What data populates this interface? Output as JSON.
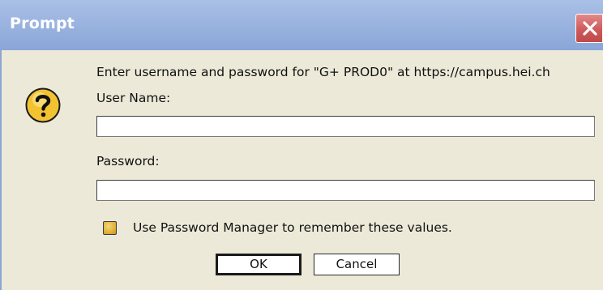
{
  "window": {
    "title": "Prompt",
    "close_icon": "close-icon",
    "titlebar_color": "#9bb4e0",
    "close_color": "#cf5a5a"
  },
  "dialog": {
    "icon": "question-icon",
    "message": "Enter username and password for \"G+ PROD0\" at https://campus.hei.ch",
    "username_label": "User Name:",
    "username_value": "",
    "password_label": "Password:",
    "password_value": "",
    "remember_label": "Use Password Manager to remember these values.",
    "remember_checked": false,
    "ok_label": "OK",
    "cancel_label": "Cancel"
  }
}
